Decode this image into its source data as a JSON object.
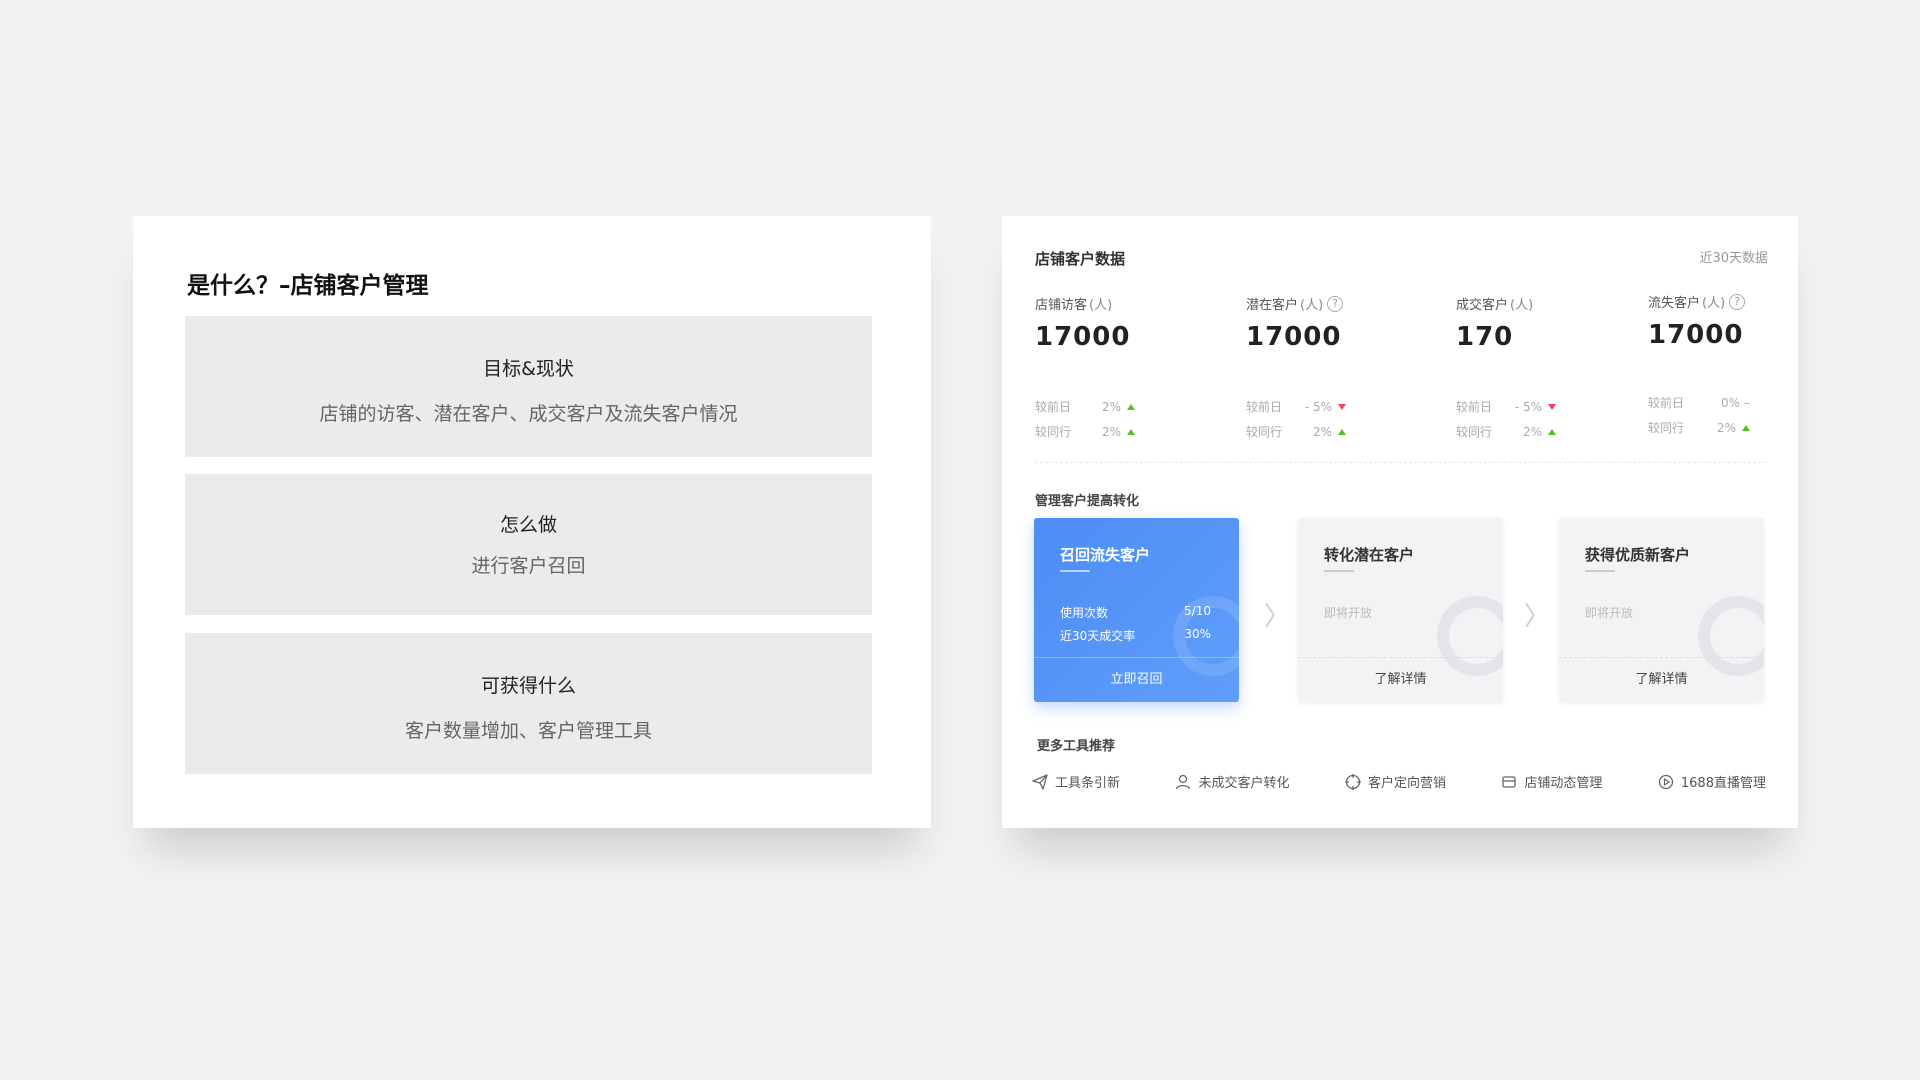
{
  "left": {
    "title": "是什么？–店铺客户管理",
    "boxes": [
      {
        "heading": "目标&现状",
        "desc": "店铺的访客、潜在客户、成交客户及流失客户情况"
      },
      {
        "heading": "怎么做",
        "desc": "进行客户召回"
      },
      {
        "heading": "可获得什么",
        "desc": "客户数量增加、客户管理工具"
      }
    ]
  },
  "right": {
    "title": "店铺客户数据",
    "range": "近30天数据",
    "stats": [
      {
        "label": "店铺访客",
        "unit": "(人)",
        "value": "17000",
        "day_label": "较前日",
        "day_value": "2%",
        "peer_label": "较同行",
        "peer_value": "2%"
      },
      {
        "label": "潜在客户",
        "unit": "(人)",
        "value": "17000",
        "day_label": "较前日",
        "day_value": "- 5%",
        "peer_label": "较同行",
        "peer_value": "2%"
      },
      {
        "label": "成交客户",
        "unit": "(人)",
        "value": "170",
        "day_label": "较前日",
        "day_value": "- 5%",
        "peer_label": "较同行",
        "peer_value": "2%"
      },
      {
        "label": "流失客户",
        "unit": "(人)",
        "value": "17000",
        "day_label": "较前日",
        "day_value": "0%",
        "peer_label": "较同行",
        "peer_value": "2%"
      }
    ],
    "section_convert": "管理客户提高转化",
    "tool_cards": [
      {
        "name": "召回流失客户",
        "row1_label": "使用次数",
        "row1_value": "5/10",
        "row2_label": "近30天成交率",
        "row2_value": "30%",
        "action": "立即召回"
      },
      {
        "name": "转化潜在客户",
        "soon": "即将开放",
        "action": "了解详情"
      },
      {
        "name": "获得优质新客户",
        "soon": "即将开放",
        "action": "了解详情"
      }
    ],
    "section_tools": "更多工具推荐",
    "tools": [
      {
        "label": "工具条引新",
        "icon": "send-icon"
      },
      {
        "label": "未成交客户转化",
        "icon": "user-icon"
      },
      {
        "label": "客户定向营销",
        "icon": "target-icon"
      },
      {
        "label": "店铺动态管理",
        "icon": "store-icon"
      },
      {
        "label": "1688直播管理",
        "icon": "play-icon"
      }
    ],
    "colors": {
      "primary": "#4d8df5",
      "up": "#52c41a",
      "down": "#f5455c"
    }
  }
}
